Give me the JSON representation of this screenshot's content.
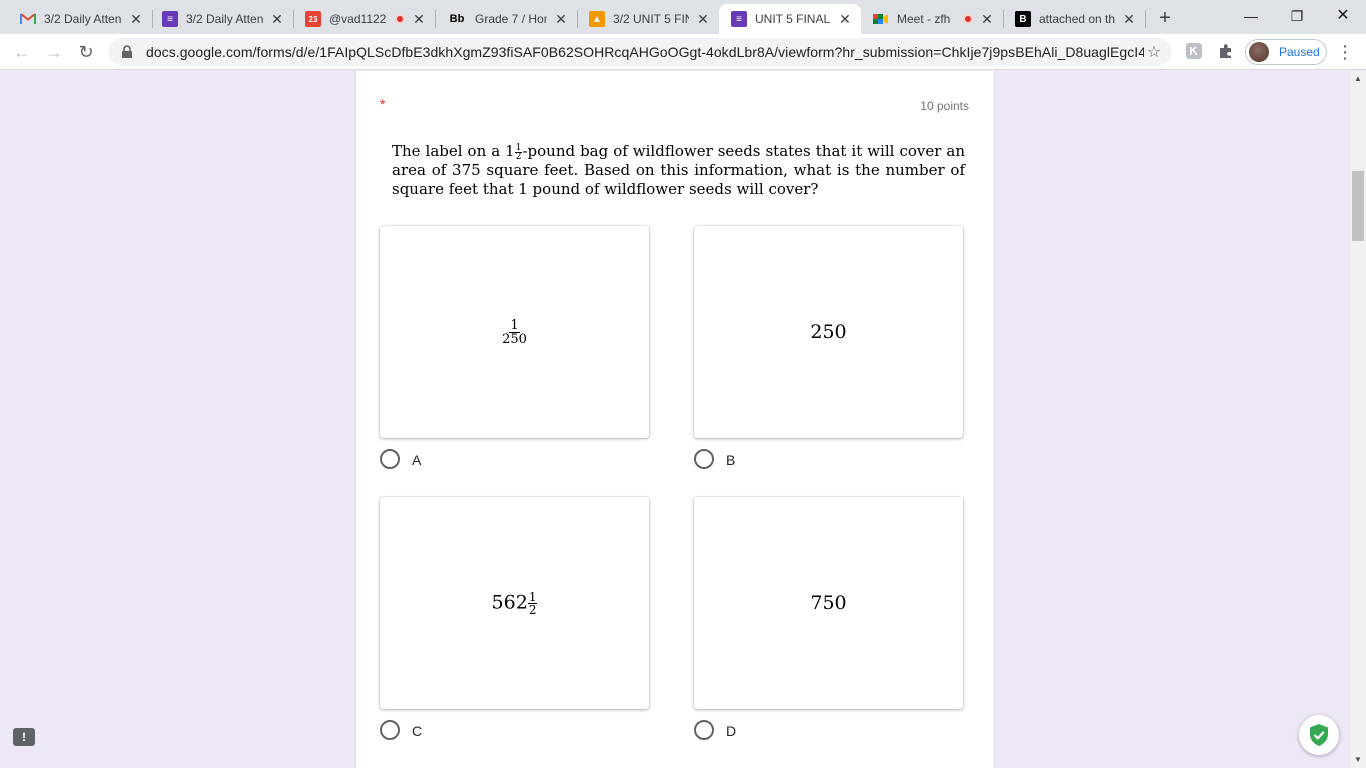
{
  "browser": {
    "tabs": [
      {
        "title": "3/2 Daily Atten",
        "icon": "gmail-icon",
        "recording": false,
        "active": false
      },
      {
        "title": "3/2 Daily Atten",
        "icon": "google-forms-icon",
        "recording": false,
        "active": false
      },
      {
        "title": "@vad1122",
        "icon": "calendar-icon",
        "recording": true,
        "active": false
      },
      {
        "title": "Grade 7 / Hom",
        "icon": "blackboard-icon",
        "recording": false,
        "active": false
      },
      {
        "title": "3/2 UNIT 5 FIN",
        "icon": "google-classroom-icon",
        "recording": false,
        "active": false
      },
      {
        "title": "UNIT 5 FINAL -",
        "icon": "google-forms-icon",
        "recording": false,
        "active": true
      },
      {
        "title": "Meet - zfh",
        "icon": "google-meet-icon",
        "recording": true,
        "active": false
      },
      {
        "title": "attached on th",
        "icon": "brainly-icon",
        "recording": false,
        "active": false
      }
    ],
    "url": "docs.google.com/forms/d/e/1FAIpQLScDfbE3dkhXgmZ93fiSAF0B62SOHRcqAHGoOGgt-4okdLbr8A/viewform?hr_submission=ChkIje7j9psBEhAli_D8uaglEgcI4O...",
    "profile_label": "Paused"
  },
  "question": {
    "required_mark": "*",
    "points": "10 points",
    "text_before": "The label on a 1",
    "whole": "1",
    "frac_num": "1",
    "frac_den": "2",
    "text_after": "-pound bag of wildflower seeds states that it will cover an area of 375 square feet.  Based on this information, what is the number of square feet that 1 pound of wildflower seeds will cover?"
  },
  "options": [
    {
      "label": "A",
      "content": {
        "type": "fraction",
        "num": "1",
        "den": "250"
      }
    },
    {
      "label": "B",
      "content": {
        "type": "text",
        "value": "250"
      }
    },
    {
      "label": "C",
      "content": {
        "type": "mixed",
        "whole": "562",
        "num": "1",
        "den": "2"
      }
    },
    {
      "label": "D",
      "content": {
        "type": "text",
        "value": "750"
      }
    }
  ]
}
